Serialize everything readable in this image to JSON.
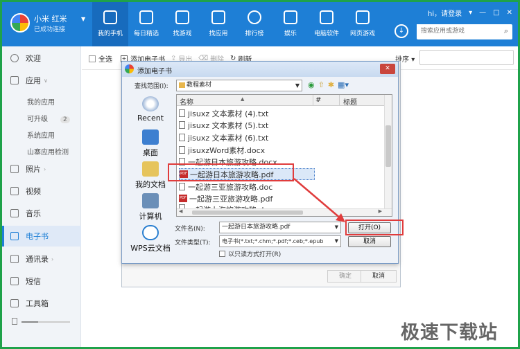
{
  "app": {
    "device_name": "小米 红米",
    "device_status": "已成功连接",
    "user_login": "hi，请登录",
    "search_placeholder": "搜索应用或游戏"
  },
  "nav_tabs": [
    {
      "label": "我的手机",
      "icon": "phone-icon"
    },
    {
      "label": "每日精选",
      "icon": "calendar-icon"
    },
    {
      "label": "找游戏",
      "icon": "gamepad-icon"
    },
    {
      "label": "找应用",
      "icon": "bag-icon"
    },
    {
      "label": "排行榜",
      "icon": "medal-icon"
    },
    {
      "label": "娱乐",
      "icon": "music-icon"
    },
    {
      "label": "电脑软件",
      "icon": "monitor-icon"
    },
    {
      "label": "网页游戏",
      "icon": "web-game-icon"
    }
  ],
  "sidebar": {
    "welcome": "欢迎",
    "apps": "应用",
    "my_apps": "我的应用",
    "upgradable": "可升级",
    "upgradable_count": "2",
    "system_apps": "系统应用",
    "fake_app_check": "山寨应用检测",
    "photos": "照片",
    "video": "视频",
    "music": "音乐",
    "ebook": "电子书",
    "contacts": "通讯录",
    "sms": "短信",
    "toolbox": "工具箱"
  },
  "toolbar": {
    "select_all": "全选",
    "add_ebook": "添加电子书",
    "export": "导出",
    "delete": "删除",
    "refresh": "刷新",
    "sort": "排序"
  },
  "background_dialog": {
    "confirm": "确定",
    "cancel": "取消"
  },
  "file_dialog": {
    "title": "添加电子书",
    "look_in_label": "查找范围(I):",
    "look_in_value": "教程素材",
    "places": [
      "Recent",
      "桌面",
      "我的文档",
      "计算机",
      "WPS云文档"
    ],
    "columns": {
      "name": "名称",
      "number": "#",
      "title": "标题"
    },
    "files": [
      "jisuxz 文本素材 (4).txt",
      "jisuxz 文本素材 (5).txt",
      "jisuxz 文本素材 (6).txt",
      "jisuxzWord素材.docx",
      "一起游日本旅游攻略.docx",
      "一起游日本旅游攻略.pdf",
      "一起游三亚旅游攻略.doc",
      "一起游三亚旅游攻略.pdf",
      "一起游上海旅游攻略.doc"
    ],
    "selected_index": 5,
    "file_name_label": "文件名(N):",
    "file_name_value": "一起游日本旅游攻略.pdf",
    "file_type_label": "文件类型(T):",
    "file_type_value": "电子书(*.txt;*.chm;*.pdf;*.ceb;*.epub",
    "readonly_label": "以只读方式打开(R)",
    "open_button": "打开(O)",
    "cancel_button": "取消"
  },
  "watermark": "极速下载站"
}
